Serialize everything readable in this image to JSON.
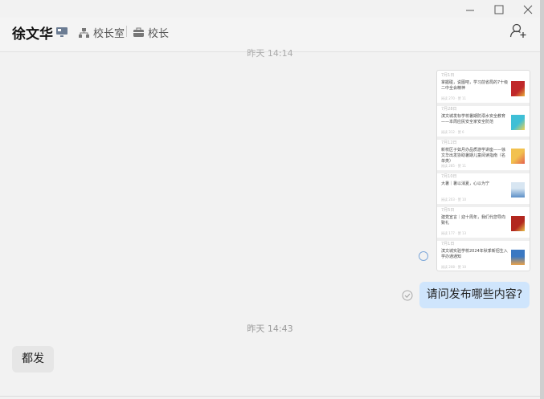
{
  "header": {
    "name": "徐文华",
    "org": "校长室",
    "role": "校长"
  },
  "timestamp_top": "昨天 14:14",
  "card": {
    "items": [
      {
        "date": "7月1日",
        "title": "掌握碰，说图吧，学习前省局的7十级二中全会精神",
        "meta": "阅读 270 · 赞 11",
        "thumb_color": "#c0282a",
        "thumb_color2": "#e8b23a"
      },
      {
        "date": "7月28日",
        "title": "滨文城发标学校暑期防溺水安全教育——本周应民安全家安全防范",
        "meta": "阅读 312 · 赞 6",
        "thumb_color": "#3fbfd6",
        "thumb_color2": "#f4d24f"
      },
      {
        "date": "7月12日",
        "title": "新校区子如月办品质游学讲座——徐文华出发协助暑期儿童阅读指南（名单类）",
        "meta": "阅读 285 · 赞 11",
        "thumb_color": "#f2c14e",
        "thumb_color2": "#e4614f"
      },
      {
        "date": "7月10日",
        "title": "大暑｜暑以消夏，心以为宁",
        "meta": "阅读 203 · 赞 10",
        "thumb_color": "#5b8fc7",
        "thumb_color2": "#d8e6f2"
      },
      {
        "date": "7月5日",
        "title": "建党宣言｜迎十周年，我们代您导向致礼",
        "meta": "阅读 177 · 赞 13",
        "thumb_color": "#b2271f",
        "thumb_color2": "#e8c24a"
      },
      {
        "date": "7月1日",
        "title": "滨文城实验学校2024年秋季新招生入学办通通知",
        "meta": "阅读 208 · 赞 10",
        "thumb_color": "#3a78c2",
        "thumb_color2": "#e8a14a"
      }
    ]
  },
  "messages": {
    "outgoing_question": "请问发布哪些内容?",
    "timestamp": "昨天 14:43",
    "incoming_reply": "都发"
  },
  "colors": {
    "outgoing_bubble": "#cfe5fc",
    "incoming_bubble": "#e6e6e6",
    "background": "#f2f2f2"
  },
  "icons": [
    "minimize-icon",
    "maximize-icon",
    "close-icon",
    "pc-status-icon",
    "org-chart-icon",
    "briefcase-icon",
    "add-user-icon"
  ]
}
